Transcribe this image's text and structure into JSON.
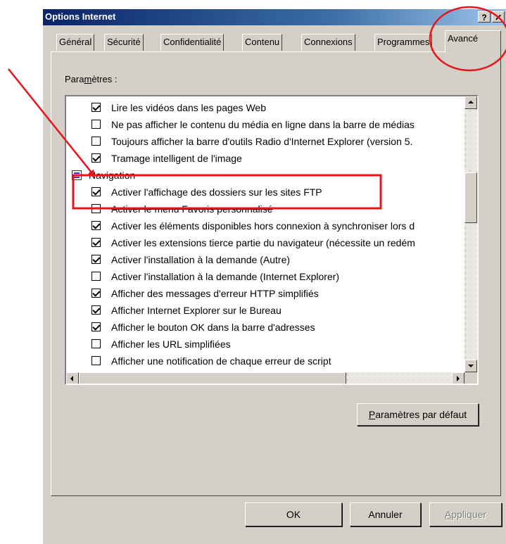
{
  "window": {
    "title": "Options Internet",
    "help_label": "?",
    "close_label": "✕"
  },
  "tabs": [
    {
      "label": "Général"
    },
    {
      "label": "Sécurité"
    },
    {
      "label": "Confidentialité"
    },
    {
      "label": "Contenu"
    },
    {
      "label": "Connexions"
    },
    {
      "label": "Programmes"
    },
    {
      "label": "Avancé",
      "active": true
    }
  ],
  "settings": {
    "group_label_pre": "Para",
    "group_label_accel": "m",
    "group_label_post": "ètres :",
    "rows": [
      {
        "label": "Lire les vidéos dans les pages Web",
        "checked": true
      },
      {
        "label": "Ne pas afficher le contenu du média en ligne dans la barre de médias",
        "checked": false
      },
      {
        "label": "Toujours afficher la barre d'outils Radio d'Internet Explorer (version 5.",
        "checked": false
      },
      {
        "label": "Tramage intelligent de l'image",
        "checked": true
      },
      {
        "label": "Navigation",
        "category": true
      },
      {
        "label": "Activer l'affichage des dossiers sur les sites FTP",
        "checked": true
      },
      {
        "label": "Activer le menu Favoris personnalisé",
        "checked": false
      },
      {
        "label": "Activer les éléments disponibles hors connexion à synchroniser lors d",
        "checked": true
      },
      {
        "label": "Activer les extensions tierce partie du navigateur (nécessite un redém",
        "checked": true
      },
      {
        "label": "Activer l'installation à la demande (Autre)",
        "checked": true
      },
      {
        "label": "Activer l'installation à la demande (Internet Explorer)",
        "checked": false
      },
      {
        "label": "Afficher des messages d'erreur HTTP simplifiés",
        "checked": true
      },
      {
        "label": "Afficher Internet Explorer sur le Bureau",
        "checked": true
      },
      {
        "label": "Afficher le bouton OK dans la barre d'adresses",
        "checked": true
      },
      {
        "label": "Afficher les URL simplifiées",
        "checked": false
      },
      {
        "label": "Afficher une notification de chaque erreur de script",
        "checked": false
      }
    ]
  },
  "buttons": {
    "defaults_accel": "P",
    "defaults_rest": "aramètres par défaut",
    "ok": "OK",
    "cancel": "Annuler",
    "apply_accel": "A",
    "apply_rest": "ppliquer"
  },
  "annotation": {
    "color": "#e8141c"
  }
}
